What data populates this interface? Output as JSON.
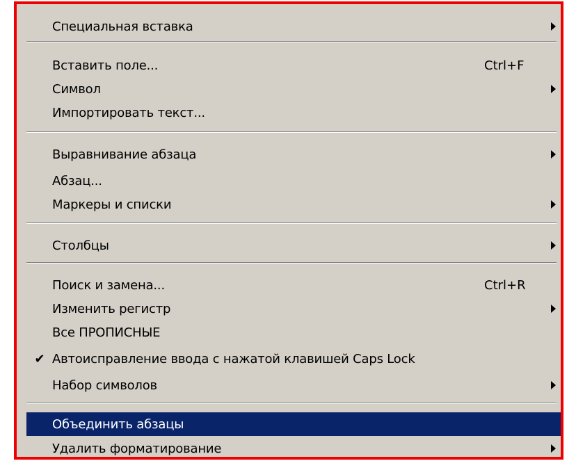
{
  "menu": {
    "items": [
      {
        "label": "Специальная вставка",
        "shortcut": "",
        "submenu": true
      },
      {
        "label": "Вставить поле...",
        "shortcut": "Ctrl+F",
        "submenu": false
      },
      {
        "label": "Символ",
        "shortcut": "",
        "submenu": true
      },
      {
        "label": "Импортировать текст...",
        "shortcut": "",
        "submenu": false
      },
      {
        "label": "Выравнивание абзаца",
        "shortcut": "",
        "submenu": true
      },
      {
        "label": "Абзац...",
        "shortcut": "",
        "submenu": false
      },
      {
        "label": "Маркеры и списки",
        "shortcut": "",
        "submenu": true
      },
      {
        "label": "Столбцы",
        "shortcut": "",
        "submenu": true
      },
      {
        "label": "Поиск и замена...",
        "shortcut": "Ctrl+R",
        "submenu": false
      },
      {
        "label": "Изменить регистр",
        "shortcut": "",
        "submenu": true
      },
      {
        "label": "Все ПРОПИСНЫЕ",
        "shortcut": "",
        "submenu": false
      },
      {
        "label": "Автоисправление ввода с нажатой клавишей Caps Lock",
        "shortcut": "",
        "submenu": false,
        "checked": true,
        "check_glyph": "✔"
      },
      {
        "label": "Набор символов",
        "shortcut": "",
        "submenu": true
      },
      {
        "label": "Объединить абзацы",
        "shortcut": "",
        "submenu": false,
        "highlighted": true
      },
      {
        "label": "Удалить форматирование",
        "shortcut": "",
        "submenu": true
      }
    ]
  },
  "colors": {
    "menu_background": "#d4d0c8",
    "highlight": "#0a246a",
    "frame_border": "#ee0000"
  }
}
